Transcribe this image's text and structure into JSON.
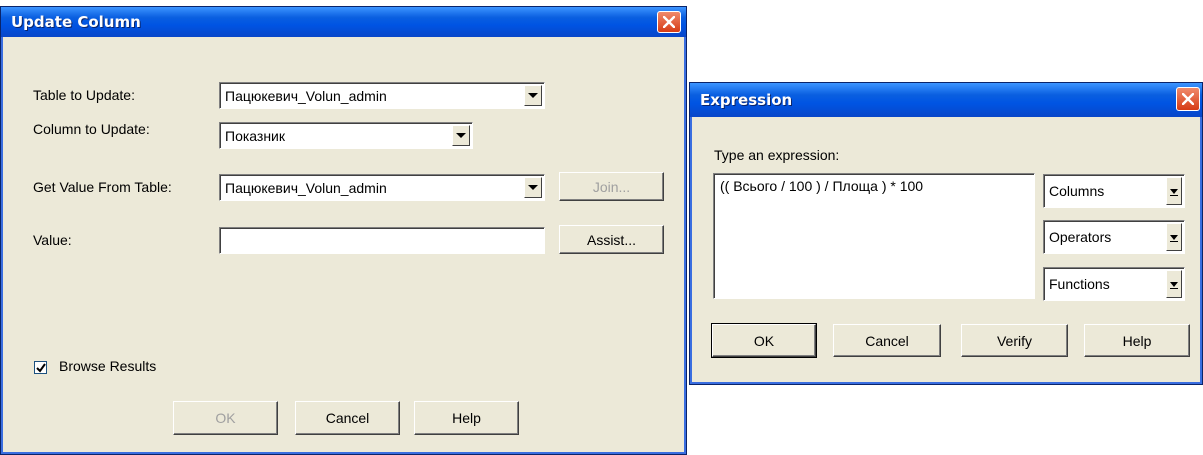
{
  "update_column": {
    "title": "Update Column",
    "table_label": "Table to Update:",
    "table_value": "Пацюкевич_Volun_admin",
    "column_label": "Column to Update:",
    "column_value": "Показник",
    "get_value_label": "Get Value From Table:",
    "get_value_value": "Пацюкевич_Volun_admin",
    "join_label": "Join...",
    "value_label": "Value:",
    "value_text": "",
    "assist_label": "Assist...",
    "browse_label": "Browse Results",
    "browse_checked": true,
    "ok_label": "OK",
    "cancel_label": "Cancel",
    "help_label": "Help"
  },
  "expression": {
    "title": "Expression",
    "prompt_label": "Type an expression:",
    "expression_text": "(( Всього / 100 ) / Площа ) * 100",
    "columns_label": "Columns",
    "operators_label": "Operators",
    "functions_label": "Functions",
    "ok_label": "OK",
    "cancel_label": "Cancel",
    "verify_label": "Verify",
    "help_label": "Help"
  },
  "colors": {
    "titlebar_blue": "#0054e3",
    "close_red": "#d63b15",
    "dialog_bg": "#ece9d8"
  }
}
